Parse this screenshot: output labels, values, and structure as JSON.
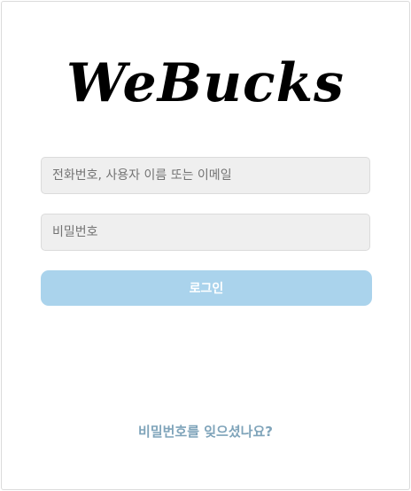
{
  "logo": {
    "text": "WeBucks"
  },
  "login_form": {
    "id_placeholder": "전화번호, 사용자 이름 또는 이메일",
    "password_placeholder": "비밀번호",
    "submit_label": "로그인",
    "submit_color": "#aad3ec"
  },
  "forgot_password": {
    "label": "비밀번호를 잊으셨나요?",
    "color": "#7fa4ba"
  }
}
